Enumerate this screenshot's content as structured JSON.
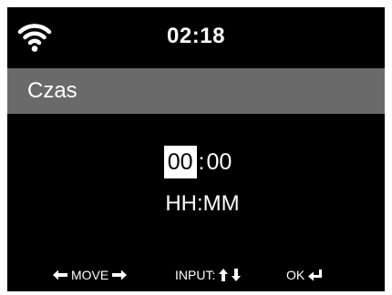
{
  "status_bar": {
    "time": "02:18",
    "wifi_icon": "wifi-icon"
  },
  "header": {
    "title": "Czas"
  },
  "time_editor": {
    "hours": "00",
    "separator": ":",
    "minutes": "00",
    "format": "HH:MM"
  },
  "footer": {
    "move_label": "MOVE",
    "input_label": "INPUT:",
    "ok_label": "OK"
  },
  "colors": {
    "background": "#000000",
    "title_bar": "#6a6a6a",
    "text": "#ffffff",
    "highlight_bg": "#ffffff",
    "highlight_text": "#000000"
  }
}
